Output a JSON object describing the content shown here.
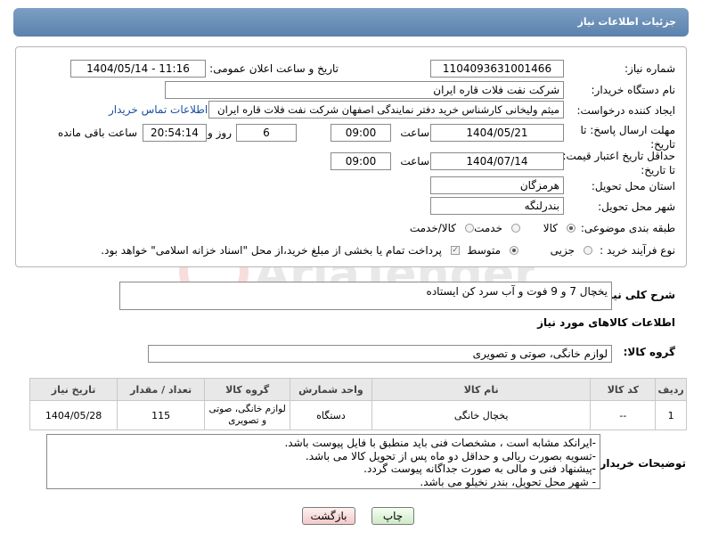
{
  "header": {
    "title": "جزئیات اطلاعات نیاز"
  },
  "fields": {
    "need_number_label": "شماره نیاز:",
    "need_number": "1104093631001466",
    "announce_label": "تاریخ و ساعت اعلان عمومی:",
    "announce_value": "1404/05/14 - 11:16",
    "buyer_org_label": "نام دستگاه خریدار:",
    "buyer_org": "شرکت نفت فلات قاره ایران",
    "creator_label": "ایجاد کننده درخواست:",
    "creator": "میثم ولیخانی کارشناس خرید دفتر نمایندگی اصفهان شرکت نفت فلات قاره ایران",
    "contact_link": "اطلاعات تماس خریدار",
    "deadline_label": "مهلت ارسال پاسخ: تا تاریخ:",
    "deadline_date": "1404/05/21",
    "time_label": "ساعت",
    "deadline_time": "09:00",
    "days": "6",
    "days_label": "روز و",
    "remaining_time": "20:54:14",
    "remaining_label": "ساعت باقی مانده",
    "min_price_label": "حداقل تاریخ اعتبار قیمت: تا تاریخ:",
    "price_date": "1404/07/14",
    "price_time": "09:00",
    "province_label": "استان محل تحویل:",
    "province": "هرمزگان",
    "city_label": "شهر محل تحویل:",
    "city": "بندرلنگه",
    "category_label": "طبقه بندی موضوعی:",
    "category_options": [
      "کالا",
      "خدمت",
      "کالا/خدمت"
    ],
    "process_label": "نوع فرآیند خرید :",
    "process_options": [
      "جزیی",
      "متوسط"
    ],
    "payment_note": "پرداخت تمام یا بخشی از مبلغ خرید،از محل \"اسناد خزانه اسلامی\" خواهد بود."
  },
  "description": {
    "label": "شرح کلی نیاز:",
    "value": "یخچال 7 و 9 فوت و آب سرد کن ایستاده"
  },
  "goods": {
    "section_title": "اطلاعات کالاهای مورد نیاز",
    "group_label": "گروه کالا:",
    "group_value": "لوازم خانگی، صوتی و تصویری"
  },
  "table": {
    "headers": [
      "ردیف",
      "کد کالا",
      "نام کالا",
      "واحد شمارش",
      "گروه کالا",
      "تعداد / مقدار",
      "تاریخ نیاز"
    ],
    "rows": [
      [
        "1",
        "--",
        "یخچال خانگی",
        "دستگاه",
        "لوازم خانگی، صوتی و تصویری",
        "115",
        "1404/05/28"
      ]
    ]
  },
  "buyer_notes": {
    "label": "توضیحات خریدار:",
    "lines": [
      "-ایرانکد مشابه است ، مشخصات فنی باید منطبق با فایل پیوست باشد.",
      "-تسویه بصورت ریالی و حداقل دو ماه پس از تحویل کالا می باشد.",
      "-پیشنهاد فنی و مالی به صورت جداگانه پیوست گردد.",
      "- شهر محل تحویل، بندر نخیلو می باشد."
    ]
  },
  "buttons": {
    "print": "چاپ",
    "back": "بازگشت"
  },
  "watermark_text": "AriaTender.neT"
}
